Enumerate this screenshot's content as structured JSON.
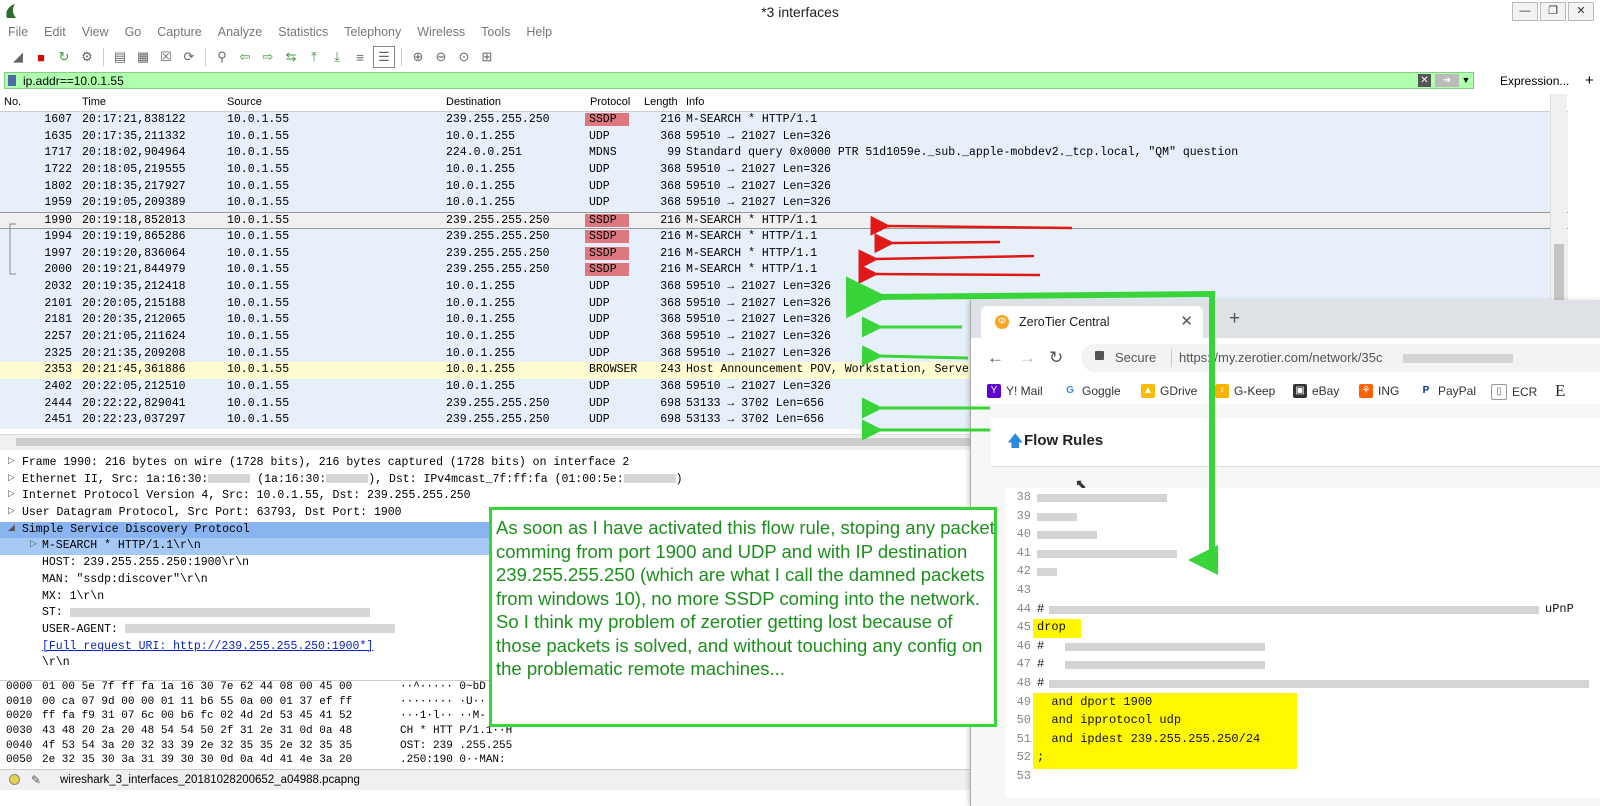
{
  "window": {
    "title": "*3 interfaces"
  },
  "menu": [
    "File",
    "Edit",
    "View",
    "Go",
    "Capture",
    "Analyze",
    "Statistics",
    "Telephony",
    "Wireless",
    "Tools",
    "Help"
  ],
  "filter": {
    "value": "ip.addr==10.0.1.55",
    "expression_label": "Expression...",
    "plus_label": "+"
  },
  "columns": {
    "no": "No.",
    "time": "Time",
    "source": "Source",
    "destination": "Destination",
    "protocol": "Protocol",
    "length": "Length",
    "info": "Info"
  },
  "packets": [
    {
      "no": "1607",
      "time": "20:17:21,838122",
      "src": "10.0.1.55",
      "dst": "239.255.255.250",
      "proto": "SSDP",
      "len": "216",
      "info": "M-SEARCH * HTTP/1.1"
    },
    {
      "no": "1635",
      "time": "20:17:35,211332",
      "src": "10.0.1.55",
      "dst": "10.0.1.255",
      "proto": "UDP",
      "len": "368",
      "info": "59510 → 21027 Len=326"
    },
    {
      "no": "1717",
      "time": "20:18:02,904964",
      "src": "10.0.1.55",
      "dst": "224.0.0.251",
      "proto": "MDNS",
      "len": "99",
      "info": "Standard query 0x0000 PTR 51d1059e._sub._apple-mobdev2._tcp.local, \"QM\" question"
    },
    {
      "no": "1722",
      "time": "20:18:05,219555",
      "src": "10.0.1.55",
      "dst": "10.0.1.255",
      "proto": "UDP",
      "len": "368",
      "info": "59510 → 21027 Len=326"
    },
    {
      "no": "1802",
      "time": "20:18:35,217927",
      "src": "10.0.1.55",
      "dst": "10.0.1.255",
      "proto": "UDP",
      "len": "368",
      "info": "59510 → 21027 Len=326"
    },
    {
      "no": "1959",
      "time": "20:19:05,209389",
      "src": "10.0.1.55",
      "dst": "10.0.1.255",
      "proto": "UDP",
      "len": "368",
      "info": "59510 → 21027 Len=326"
    },
    {
      "no": "1990",
      "time": "20:19:18,852013",
      "src": "10.0.1.55",
      "dst": "239.255.255.250",
      "proto": "SSDP",
      "len": "216",
      "info": "M-SEARCH * HTTP/1.1"
    },
    {
      "no": "1994",
      "time": "20:19:19,865286",
      "src": "10.0.1.55",
      "dst": "239.255.255.250",
      "proto": "SSDP",
      "len": "216",
      "info": "M-SEARCH * HTTP/1.1"
    },
    {
      "no": "1997",
      "time": "20:19:20,836064",
      "src": "10.0.1.55",
      "dst": "239.255.255.250",
      "proto": "SSDP",
      "len": "216",
      "info": "M-SEARCH * HTTP/1.1"
    },
    {
      "no": "2000",
      "time": "20:19:21,844979",
      "src": "10.0.1.55",
      "dst": "239.255.255.250",
      "proto": "SSDP",
      "len": "216",
      "info": "M-SEARCH * HTTP/1.1"
    },
    {
      "no": "2032",
      "time": "20:19:35,212418",
      "src": "10.0.1.55",
      "dst": "10.0.1.255",
      "proto": "UDP",
      "len": "368",
      "info": "59510 → 21027 Len=326"
    },
    {
      "no": "2101",
      "time": "20:20:05,215188",
      "src": "10.0.1.55",
      "dst": "10.0.1.255",
      "proto": "UDP",
      "len": "368",
      "info": "59510 → 21027 Len=326"
    },
    {
      "no": "2181",
      "time": "20:20:35,212065",
      "src": "10.0.1.55",
      "dst": "10.0.1.255",
      "proto": "UDP",
      "len": "368",
      "info": "59510 → 21027 Len=326"
    },
    {
      "no": "2257",
      "time": "20:21:05,211624",
      "src": "10.0.1.55",
      "dst": "10.0.1.255",
      "proto": "UDP",
      "len": "368",
      "info": "59510 → 21027 Len=326"
    },
    {
      "no": "2325",
      "time": "20:21:35,209208",
      "src": "10.0.1.55",
      "dst": "10.0.1.255",
      "proto": "UDP",
      "len": "368",
      "info": "59510 → 21027 Len=326"
    },
    {
      "no": "2353",
      "time": "20:21:45,361886",
      "src": "10.0.1.55",
      "dst": "10.0.1.255",
      "proto": "BROWSER",
      "len": "243",
      "info": "Host Announcement POV, Workstation, Server"
    },
    {
      "no": "2402",
      "time": "20:22:05,212510",
      "src": "10.0.1.55",
      "dst": "10.0.1.255",
      "proto": "UDP",
      "len": "368",
      "info": "59510 → 21027 Len=326"
    },
    {
      "no": "2444",
      "time": "20:22:22,829041",
      "src": "10.0.1.55",
      "dst": "239.255.255.250",
      "proto": "UDP",
      "len": "698",
      "info": "53133 → 3702 Len=656"
    },
    {
      "no": "2451",
      "time": "20:22:23,037297",
      "src": "10.0.1.55",
      "dst": "239.255.255.250",
      "proto": "UDP",
      "len": "698",
      "info": "53133 → 3702 Len=656"
    }
  ],
  "details": {
    "frame": "Frame 1990: 216 bytes on wire (1728 bits), 216 bytes captured (1728 bits) on interface 2",
    "eth_a": "Ethernet II, Src: 1a:16:30:",
    "eth_b": " (1a:16:30:",
    "eth_c": "), Dst: IPv4mcast_7f:ff:fa (01:00:5e:",
    "eth_d": ")",
    "ip": "Internet Protocol Version 4, Src: 10.0.1.55, Dst: 239.255.255.250",
    "udp": "User Datagram Protocol, Src Port: 63793, Dst Port: 1900",
    "ssdp": "Simple Service Discovery Protocol",
    "msearch": "M-SEARCH * HTTP/1.1\\r\\n",
    "host": "HOST: 239.255.255.250:1900\\r\\n",
    "man": "MAN: \"ssdp:discover\"\\r\\n",
    "mx": "MX: 1\\r\\n",
    "st": "ST:",
    "ua": "USER-AGENT:",
    "uri": "[Full request URI: http://239.255.255.250:1900*]",
    "crlf": "\\r\\n"
  },
  "hex": [
    {
      "off": "0000",
      "bytes": "01 00 5e 7f ff fa 1a 16  30 7e 62 44 08 00 45 00",
      "ascii": "··^····· 0~bD"
    },
    {
      "off": "0010",
      "bytes": "00 ca 07 9d 00 00 01 11  b6 55 0a 00 01 37 ef ff",
      "ascii": "········ ·U··"
    },
    {
      "off": "0020",
      "bytes": "ff fa f9 31 07 6c 00 b6  fc 02 4d 2d 53 45 41 52",
      "ascii": "···1·l·· ··M-"
    },
    {
      "off": "0030",
      "bytes": "43 48 20 2a 20 48 54 54  50 2f 31 2e 31 0d 0a 48",
      "ascii": "CH * HTT P/1.1··H"
    },
    {
      "off": "0040",
      "bytes": "4f 53 54 3a 20 32 33 39  2e 32 35 35 2e 32 35 35",
      "ascii": "OST: 239 .255.255"
    },
    {
      "off": "0050",
      "bytes": "2e 32 35 30 3a 31 39 30  30 0d 0a 4d 41 4e 3a 20",
      "ascii": ".250:190 0··MAN:"
    }
  ],
  "status": {
    "file": "wireshark_3_interfaces_20181028200652_a04988.pcapng"
  },
  "browser": {
    "tab_title": "ZeroTier Central",
    "secure_label": "Secure",
    "url": "https://my.zerotier.com/network/35c",
    "bookmarks": [
      "Y! Mail",
      "Goggle",
      "GDrive",
      "G-Keep",
      "eBay",
      "ING",
      "PayPal",
      "ECR"
    ],
    "panel_title": "Flow Rules",
    "lines": [
      {
        "n": "38",
        "code": ""
      },
      {
        "n": "39",
        "code": ""
      },
      {
        "n": "40",
        "code": ""
      },
      {
        "n": "41",
        "code": ""
      },
      {
        "n": "42",
        "code": ""
      },
      {
        "n": "43",
        "code": ""
      },
      {
        "n": "44",
        "code": "#"
      },
      {
        "n": "45",
        "code": "drop"
      },
      {
        "n": "46",
        "code": "#"
      },
      {
        "n": "47",
        "code": "#"
      },
      {
        "n": "48",
        "code": "#"
      },
      {
        "n": "49",
        "code": "  and dport 1900"
      },
      {
        "n": "50",
        "code": "  and ipprotocol udp"
      },
      {
        "n": "51",
        "code": "  and ipdest 239.255.255.250/24"
      },
      {
        "n": "52",
        "code": ";"
      },
      {
        "n": "53",
        "code": ""
      }
    ],
    "line44_tail": "uPnP"
  },
  "callout": {
    "text": "As soon as I have activated this flow rule, stoping any packet comming from port 1900 and UDP and with IP destination 239.255.255.250 (which are what I call the damned packets from windows 10), no more SSDP coming into the network. So I think my problem of zerotier getting lost because of those packets is solved, and without touching any config on the problematic remote machines..."
  },
  "colors": {
    "filter_ok": "#afffaf",
    "ssdp_proto": "#dd7880",
    "row_default": "#e7f0fa",
    "row_browser": "#fefcd0",
    "highlight": "#fff700",
    "annotation_green": "#39d43a",
    "annotation_red": "#e01818"
  }
}
